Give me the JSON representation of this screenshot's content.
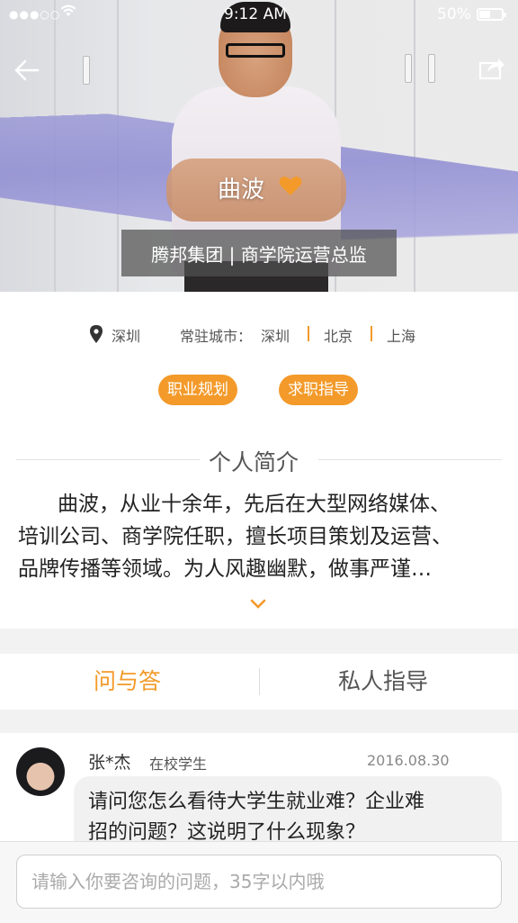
{
  "status_bar": {
    "time": "9:12 AM",
    "battery": "50%"
  },
  "profile": {
    "name": "曲波",
    "title": "腾邦集团 | 商学院运营总监",
    "location": "深圳",
    "resident_label": "常驻城市：",
    "resident_cities": [
      "深圳",
      "北京",
      "上海"
    ],
    "tags": [
      "职业规划",
      "求职指导"
    ],
    "intro_heading": "个人简介",
    "intro_lines": [
      "曲波，从业十余年，先后在大型网络媒体、",
      "培训公司、商学院任职，擅长项目策划及运营、",
      "品牌传播等领域。为人风趣幽默，做事严谨…"
    ]
  },
  "tabs": {
    "qa": "问与答",
    "private": "私人指导"
  },
  "question": {
    "user": "张*杰",
    "role": "在校学生",
    "date": "2016.08.30",
    "text_lines": [
      "请问您怎么看待大学生就业难？企业难",
      "招的问题？这说明了什么现象？"
    ]
  },
  "input": {
    "placeholder": "请输入你要咨询的问题，35字以内哦"
  },
  "colors": {
    "accent": "#f39a2a"
  },
  "icons": [
    "back-arrow-icon",
    "share-icon",
    "heart-icon",
    "location-pin-icon",
    "chevron-down-icon",
    "wifi-icon"
  ]
}
